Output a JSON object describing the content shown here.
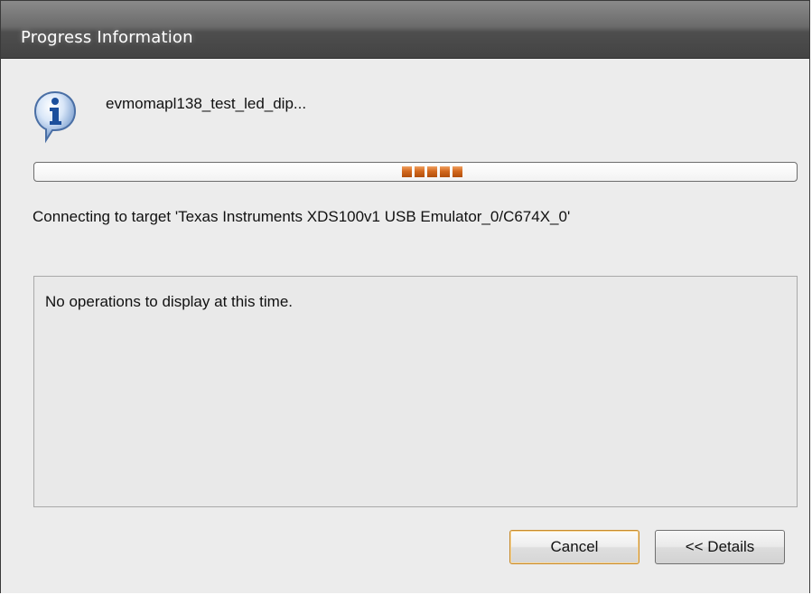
{
  "window": {
    "title": "Progress Information"
  },
  "task": {
    "icon": "info-icon",
    "name": "evmomapl138_test_led_dip..."
  },
  "progress": {
    "mode": "indeterminate",
    "blocks": 5,
    "color": "#d3691e"
  },
  "status": {
    "text": "Connecting to target 'Texas Instruments XDS100v1 USB Emulator_0/C674X_0'"
  },
  "operations": {
    "empty_text": "No operations to display at this time."
  },
  "buttons": {
    "cancel_label": "Cancel",
    "details_label": "<< Details"
  },
  "colors": {
    "title_bar": "#5a5a5a",
    "dialog_bg": "#ececec",
    "default_button_border": "#c78a2c"
  }
}
